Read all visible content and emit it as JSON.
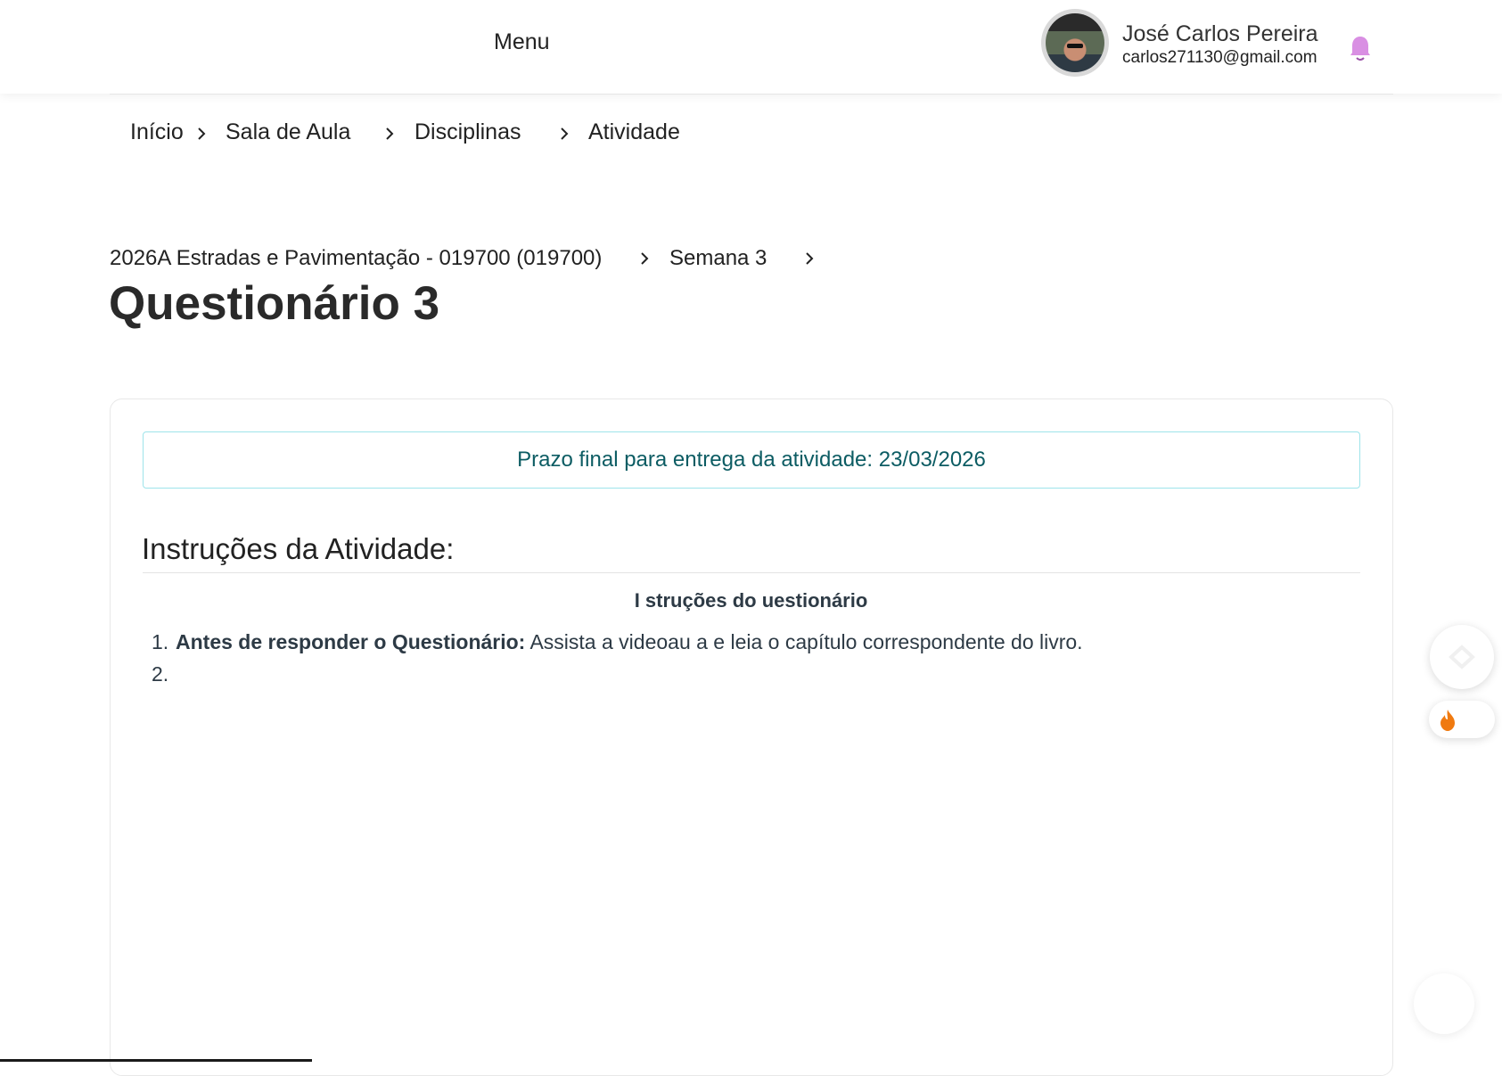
{
  "header": {
    "menu_label": "Menu",
    "user_name": "José Carlos Pereira",
    "user_email": "carlos271130@gmail.com"
  },
  "breadcrumb": {
    "items": [
      "Início",
      "Sala de Aula",
      "Disciplinas",
      "Atividade"
    ]
  },
  "course": {
    "subtitle": "2026A Estradas e Pavimentação - 019700 (019700)",
    "week": "Semana 3"
  },
  "page_title": "Questionário 3",
  "activity": {
    "deadline_text": "Prazo final para entrega da atividade: 23/03/2026",
    "instructions_title": "Instruções da Atividade:",
    "quiz_heading": "I  struções do    uestionário",
    "list": [
      {
        "num": "1.",
        "bold": "Antes de responder o Questionário:",
        "text": " Assista a videoau a e leia o capítulo correspondente do livro."
      },
      {
        "num": "2.",
        "bold": "",
        "text": ""
      }
    ]
  },
  "colors": {
    "deadline_border": "#9ee4ea",
    "deadline_text": "#0c5c63",
    "bell": "#d98fe3",
    "flame": "#f07a10"
  },
  "icons": [
    "bell-icon",
    "chevron-right-icon",
    "flame-icon",
    "chat-icon",
    "avatar"
  ]
}
